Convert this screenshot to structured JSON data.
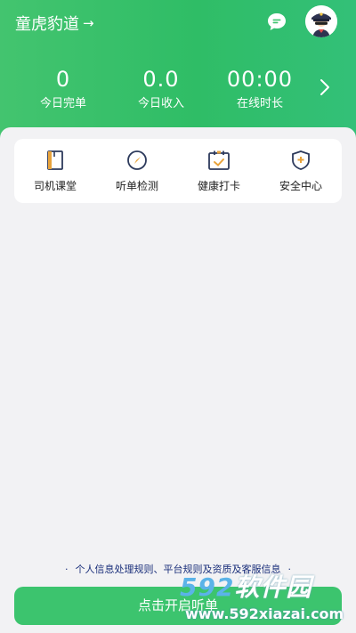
{
  "header": {
    "brand_name": "童虎豹道",
    "brand_arrow": "→",
    "chat_icon": "chat-bubble-icon",
    "avatar": "driver-avatar"
  },
  "stats": [
    {
      "value": "0",
      "label": "今日完单"
    },
    {
      "value": "0.0",
      "label": "今日收入"
    },
    {
      "value": "00:00",
      "label": "在线时长"
    }
  ],
  "quick_actions": [
    {
      "label": "司机课堂",
      "icon": "notebook-icon"
    },
    {
      "label": "听单检测",
      "icon": "compass-icon"
    },
    {
      "label": "健康打卡",
      "icon": "calendar-check-icon"
    },
    {
      "label": "安全中心",
      "icon": "shield-icon"
    }
  ],
  "footer": {
    "policy_text": "个人信息处理规则、平台规则及资质及客服信息",
    "start_button_label": "点击开启听单"
  },
  "watermark": {
    "digits": "592",
    "text": "软件园",
    "url": "www.592xiazai.com"
  },
  "colors": {
    "brand_green": "#3cc46e",
    "header_gradient_start": "#43c46f",
    "header_gradient_end": "#33c078",
    "policy_link": "#1a2f7a",
    "background": "#f2f2f4"
  }
}
